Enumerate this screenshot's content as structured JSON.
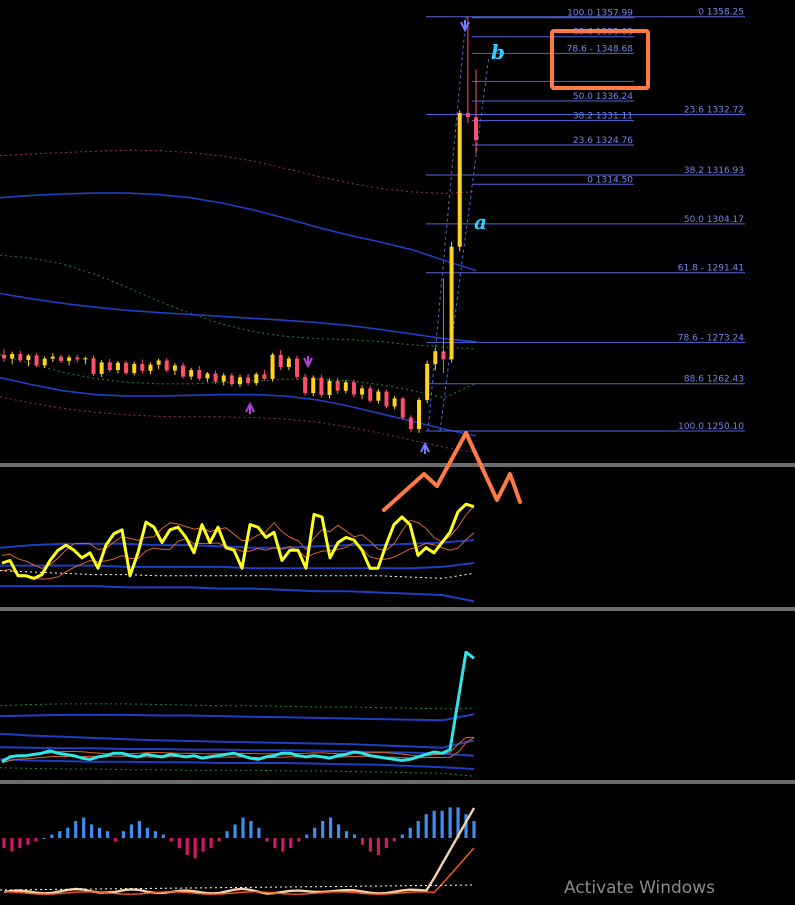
{
  "chart_data": {
    "type": "candlestick",
    "price_range": [
      1242,
      1360
    ],
    "colors": {
      "background": "#000000",
      "bull_candle": "#ffd21f",
      "bear_candle": "#ff4f6a",
      "fib_line": "#4f66d8",
      "fib_text": "#6f86e6",
      "band_blue": "#1e3fc2",
      "indicator_yellow": "#ffff1a",
      "indicator_cyan": "#2ee6e6",
      "annotation_orange": "#ff7a45",
      "hist_blue": "#3d8ef0",
      "hist_magenta": "#d0186a",
      "separator": "#d8d8d8"
    },
    "fib_retracement_right": [
      {
        "level": "0",
        "price": 1358.25,
        "label": "0 1358.25"
      },
      {
        "level": "23.6",
        "price": 1332.72,
        "label": "23.6 1332.72"
      },
      {
        "level": "38.2",
        "price": 1316.93,
        "label": "38.2 1316.93"
      },
      {
        "level": "50.0",
        "price": 1304.17,
        "label": "50.0 1304.17"
      },
      {
        "level": "61.8",
        "price": 1291.41,
        "label": "61.8 - 1291.41"
      },
      {
        "level": "78.6",
        "price": 1273.24,
        "label": "78.6 - 1273.24"
      },
      {
        "level": "88.6",
        "price": 1262.43,
        "label": "88.6 1262.43"
      },
      {
        "level": "100.0",
        "price": 1250.1,
        "label": "100.0 1250.10"
      }
    ],
    "fib_retracement_left": [
      {
        "level": "100.0",
        "price": 1357.99,
        "label": "100.0 1357.99"
      },
      {
        "level": "88.6",
        "price": 1353.03,
        "label": "88.6 1353.03"
      },
      {
        "level": "78.6",
        "price": 1348.68,
        "label": "78.6 - 1348.68"
      },
      {
        "level": "61.8",
        "price": 1341.37,
        "label": ""
      },
      {
        "level": "50.0",
        "price": 1336.24,
        "label": "50.0 1336.24"
      },
      {
        "level": "38.2",
        "price": 1331.11,
        "label": "38.2 1331.11"
      },
      {
        "level": "23.6",
        "price": 1324.76,
        "label": "23.6 1324.76"
      },
      {
        "level": "0",
        "price": 1314.5,
        "label": "0 1314.50"
      }
    ],
    "wave_labels": {
      "a": "a",
      "b": "b"
    },
    "candles": [
      [
        1270.0,
        1271.5,
        1268.2,
        1269.0
      ],
      [
        1269.0,
        1270.8,
        1267.5,
        1270.2
      ],
      [
        1270.2,
        1271.0,
        1268.0,
        1268.6
      ],
      [
        1268.6,
        1270.2,
        1267.0,
        1269.8
      ],
      [
        1269.8,
        1270.5,
        1266.8,
        1267.2
      ],
      [
        1267.2,
        1269.6,
        1266.5,
        1269.0
      ],
      [
        1269.0,
        1270.4,
        1268.1,
        1269.5
      ],
      [
        1269.5,
        1270.1,
        1267.8,
        1268.4
      ],
      [
        1268.4,
        1269.9,
        1267.2,
        1269.3
      ],
      [
        1269.3,
        1270.0,
        1268.0,
        1268.8
      ],
      [
        1268.8,
        1269.5,
        1267.5,
        1269.1
      ],
      [
        1269.1,
        1269.8,
        1264.5,
        1265.0
      ],
      [
        1265.0,
        1268.6,
        1264.2,
        1268.0
      ],
      [
        1268.0,
        1268.9,
        1265.5,
        1266.0
      ],
      [
        1266.0,
        1268.4,
        1265.2,
        1267.9
      ],
      [
        1267.9,
        1268.5,
        1264.8,
        1265.2
      ],
      [
        1265.2,
        1268.2,
        1264.6,
        1267.6
      ],
      [
        1267.6,
        1268.8,
        1265.0,
        1265.8
      ],
      [
        1265.8,
        1268.0,
        1264.9,
        1267.4
      ],
      [
        1267.4,
        1269.0,
        1266.2,
        1268.5
      ],
      [
        1268.5,
        1269.1,
        1265.4,
        1265.9
      ],
      [
        1265.9,
        1267.8,
        1264.7,
        1267.2
      ],
      [
        1267.2,
        1268.0,
        1263.8,
        1264.3
      ],
      [
        1264.3,
        1266.6,
        1263.5,
        1266.0
      ],
      [
        1266.0,
        1267.1,
        1263.2,
        1263.8
      ],
      [
        1263.8,
        1265.5,
        1262.9,
        1265.1
      ],
      [
        1265.1,
        1265.9,
        1262.4,
        1263.0
      ],
      [
        1263.0,
        1265.2,
        1262.0,
        1264.6
      ],
      [
        1264.6,
        1265.3,
        1261.8,
        1262.3
      ],
      [
        1262.3,
        1264.8,
        1261.5,
        1264.1
      ],
      [
        1264.1,
        1265.0,
        1262.0,
        1262.6
      ],
      [
        1262.6,
        1265.4,
        1262.0,
        1264.9
      ],
      [
        1264.9,
        1266.0,
        1263.2,
        1263.7
      ],
      [
        1263.7,
        1270.5,
        1263.0,
        1270.0
      ],
      [
        1270.0,
        1271.2,
        1266.0,
        1266.8
      ],
      [
        1266.8,
        1269.6,
        1266.0,
        1269.0
      ],
      [
        1269.0,
        1269.8,
        1263.5,
        1264.2
      ],
      [
        1264.2,
        1265.0,
        1259.4,
        1260.0
      ],
      [
        1260.0,
        1264.6,
        1259.2,
        1264.0
      ],
      [
        1264.0,
        1264.8,
        1258.8,
        1259.5
      ],
      [
        1259.5,
        1263.8,
        1258.6,
        1263.2
      ],
      [
        1263.2,
        1264.0,
        1259.8,
        1260.6
      ],
      [
        1260.6,
        1263.4,
        1259.9,
        1262.8
      ],
      [
        1262.8,
        1263.5,
        1259.0,
        1259.6
      ],
      [
        1259.6,
        1262.0,
        1258.4,
        1261.2
      ],
      [
        1261.2,
        1262.0,
        1257.5,
        1258.0
      ],
      [
        1258.0,
        1261.0,
        1257.2,
        1260.4
      ],
      [
        1260.4,
        1260.9,
        1256.0,
        1256.5
      ],
      [
        1256.5,
        1259.2,
        1255.8,
        1258.6
      ],
      [
        1258.6,
        1259.0,
        1253.0,
        1253.6
      ],
      [
        1253.6,
        1254.2,
        1249.8,
        1250.6
      ],
      [
        1250.6,
        1258.8,
        1249.6,
        1258.2
      ],
      [
        1258.2,
        1268.5,
        1257.4,
        1267.6
      ],
      [
        1267.6,
        1271.8,
        1266.0,
        1270.9
      ],
      [
        1270.9,
        1290.0,
        1265.2,
        1268.8
      ],
      [
        1268.8,
        1299.5,
        1268.0,
        1298.2
      ],
      [
        1298.2,
        1333.8,
        1297.0,
        1333.1
      ],
      [
        1333.1,
        1358.2,
        1330.5,
        1332.0
      ],
      [
        1332.0,
        1344.5,
        1322.5,
        1326.0
      ]
    ],
    "bands": [
      {
        "name": "outer_upper",
        "dash": true,
        "color": "#a02a6a",
        "y": [
          1322,
          1322.4,
          1322.8,
          1323.1,
          1323.4,
          1323.3,
          1322.8,
          1321.9,
          1320.5,
          1318.6,
          1316.6,
          1314.8,
          1313.4,
          1312.5,
          1312.1,
          1312.6
        ]
      },
      {
        "name": "blue_upper",
        "dash": false,
        "color": "#1e3fc2",
        "y": [
          1311,
          1311.6,
          1312.0,
          1312.2,
          1312.2,
          1311.8,
          1311.0,
          1309.6,
          1307.8,
          1305.6,
          1303.3,
          1301.2,
          1299.4,
          1297.4,
          1294.6,
          1292.0
        ]
      },
      {
        "name": "green_upper",
        "dash": true,
        "color": "#1e8a2a",
        "y": [
          1296,
          1295.2,
          1293.6,
          1291.0,
          1287.6,
          1284.0,
          1280.8,
          1278.0,
          1276.0,
          1274.8,
          1274.2,
          1274.0,
          1273.4,
          1272.6,
          1272.0,
          1271.5
        ]
      },
      {
        "name": "blue_mid",
        "dash": false,
        "color": "#1e3fc2",
        "y": [
          1286,
          1284.6,
          1283.4,
          1282.4,
          1281.6,
          1281.0,
          1280.5,
          1280.0,
          1279.5,
          1279.0,
          1278.4,
          1277.6,
          1276.6,
          1275.4,
          1274.2,
          1273.4
        ]
      },
      {
        "name": "green_lower",
        "dash": true,
        "color": "#1e8a2a",
        "y": [
          1270,
          1267.6,
          1265.4,
          1263.8,
          1262.8,
          1262.4,
          1262.4,
          1262.8,
          1263.2,
          1263.6,
          1263.6,
          1263.2,
          1262.2,
          1260.6,
          1258.8,
          1262.5
        ]
      },
      {
        "name": "blue_lower",
        "dash": false,
        "color": "#1e3fc2",
        "y": [
          1264,
          1262.2,
          1260.6,
          1259.6,
          1259.2,
          1259.2,
          1259.4,
          1259.6,
          1259.6,
          1259.2,
          1258.2,
          1256.6,
          1254.6,
          1252.6,
          1250.6,
          1248.8
        ]
      },
      {
        "name": "outer_lower",
        "dash": true,
        "color": "#a02a6a",
        "y": [
          1259,
          1257.4,
          1256.0,
          1255.0,
          1254.3,
          1253.9,
          1253.8,
          1253.8,
          1253.6,
          1253.2,
          1252.4,
          1251.1,
          1249.5,
          1247.7,
          1245.8,
          1244.5
        ]
      }
    ],
    "stoch_main": [
      32,
      34,
      22,
      22,
      20,
      23,
      34,
      42,
      46,
      42,
      36,
      40,
      28,
      46,
      55,
      58,
      22,
      40,
      64,
      60,
      48,
      58,
      60,
      52,
      40,
      62,
      48,
      60,
      44,
      42,
      28,
      62,
      60,
      52,
      56,
      34,
      42,
      42,
      28,
      70,
      68,
      36,
      48,
      52,
      50,
      42,
      28,
      28,
      46,
      62,
      68,
      62,
      38,
      44,
      40,
      48,
      56,
      72,
      78,
      76
    ],
    "cci_main": [
      20,
      28,
      30,
      30,
      32,
      34,
      38,
      34,
      32,
      30,
      26,
      24,
      28,
      30,
      34,
      34,
      30,
      28,
      32,
      30,
      28,
      32,
      30,
      28,
      30,
      26,
      28,
      30,
      32,
      34,
      30,
      26,
      24,
      28,
      30,
      34,
      34,
      30,
      28,
      30,
      28,
      26,
      30,
      32,
      36,
      34,
      30,
      28,
      26,
      24,
      22,
      24,
      28,
      32,
      36,
      34,
      40,
      120,
      200,
      190
    ],
    "histogram": [
      -3,
      -4,
      -3,
      -2,
      -1,
      0,
      1,
      2,
      3,
      5,
      6,
      4,
      3,
      2,
      -1,
      2,
      4,
      5,
      3,
      2,
      1,
      -1,
      -3,
      -5,
      -6,
      -4,
      -3,
      -1,
      2,
      4,
      6,
      5,
      3,
      -1,
      -3,
      -4,
      -3,
      -1,
      1,
      3,
      5,
      6,
      4,
      2,
      1,
      -2,
      -4,
      -5,
      -3,
      -1,
      1,
      3,
      5,
      7,
      8,
      8,
      9,
      9,
      7,
      5
    ]
  },
  "watermark": "Activate Windows"
}
